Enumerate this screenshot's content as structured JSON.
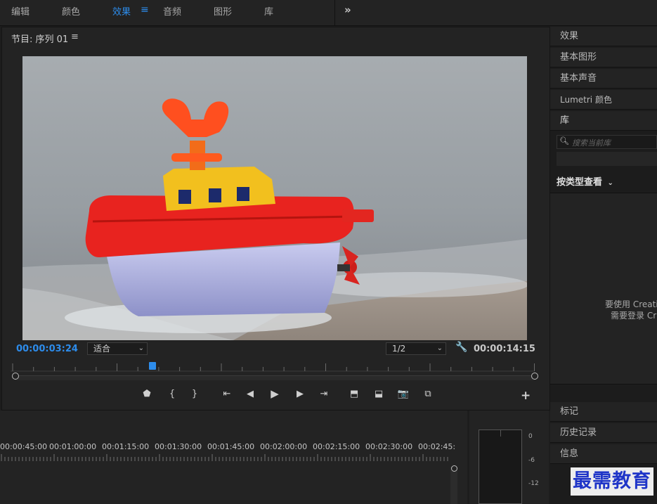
{
  "topbar": {
    "tabs": [
      "编辑",
      "颜色",
      "效果",
      "音频",
      "图形",
      "库"
    ],
    "active_tab": "效果",
    "menu_icon": "≡",
    "more_icon": "»"
  },
  "monitor": {
    "title": "节目: 序列 01",
    "menu_icon": "≡",
    "current_timecode": "00:00:03:24",
    "fit_value": "适合",
    "resolution_value": "1/2",
    "duration_timecode": "00:00:14:15"
  },
  "controls": {
    "marker": "⬟",
    "in_point": "{",
    "out_point": "}",
    "go_to_in": "⇤",
    "step_back": "◀",
    "play": "▶",
    "step_forward": "▶",
    "go_to_out": "⇥",
    "lift": "⬒",
    "extract": "⬓",
    "export_frame": "📷",
    "compare": "⧉",
    "add": "+"
  },
  "right_panel": {
    "items": [
      "效果",
      "基本图形",
      "基本声音",
      "Lumetri 颜色",
      "库"
    ],
    "search_placeholder": "搜索当前库",
    "view_by_type": "按类型查看",
    "message_line1": "要使用 Creative",
    "message_line2": "需要登录 Cr",
    "bottom_items": [
      "标记",
      "历史记录",
      "信息"
    ]
  },
  "timeline": {
    "labels": [
      "00:00:45:00",
      "00:01:00:00",
      "00:01:15:00",
      "00:01:30:00",
      "00:01:45:00",
      "00:02:00:00",
      "00:02:15:00",
      "00:02:30:00",
      "00:02:45:"
    ]
  },
  "meter": {
    "db_labels": [
      "0",
      "-6",
      "-12"
    ]
  },
  "watermark": "最需教育",
  "colors": {
    "accent": "#2d8ceb",
    "boat_red": "#e8231f",
    "boat_yellow": "#f2c01e",
    "watermark": "#1f35c8"
  }
}
